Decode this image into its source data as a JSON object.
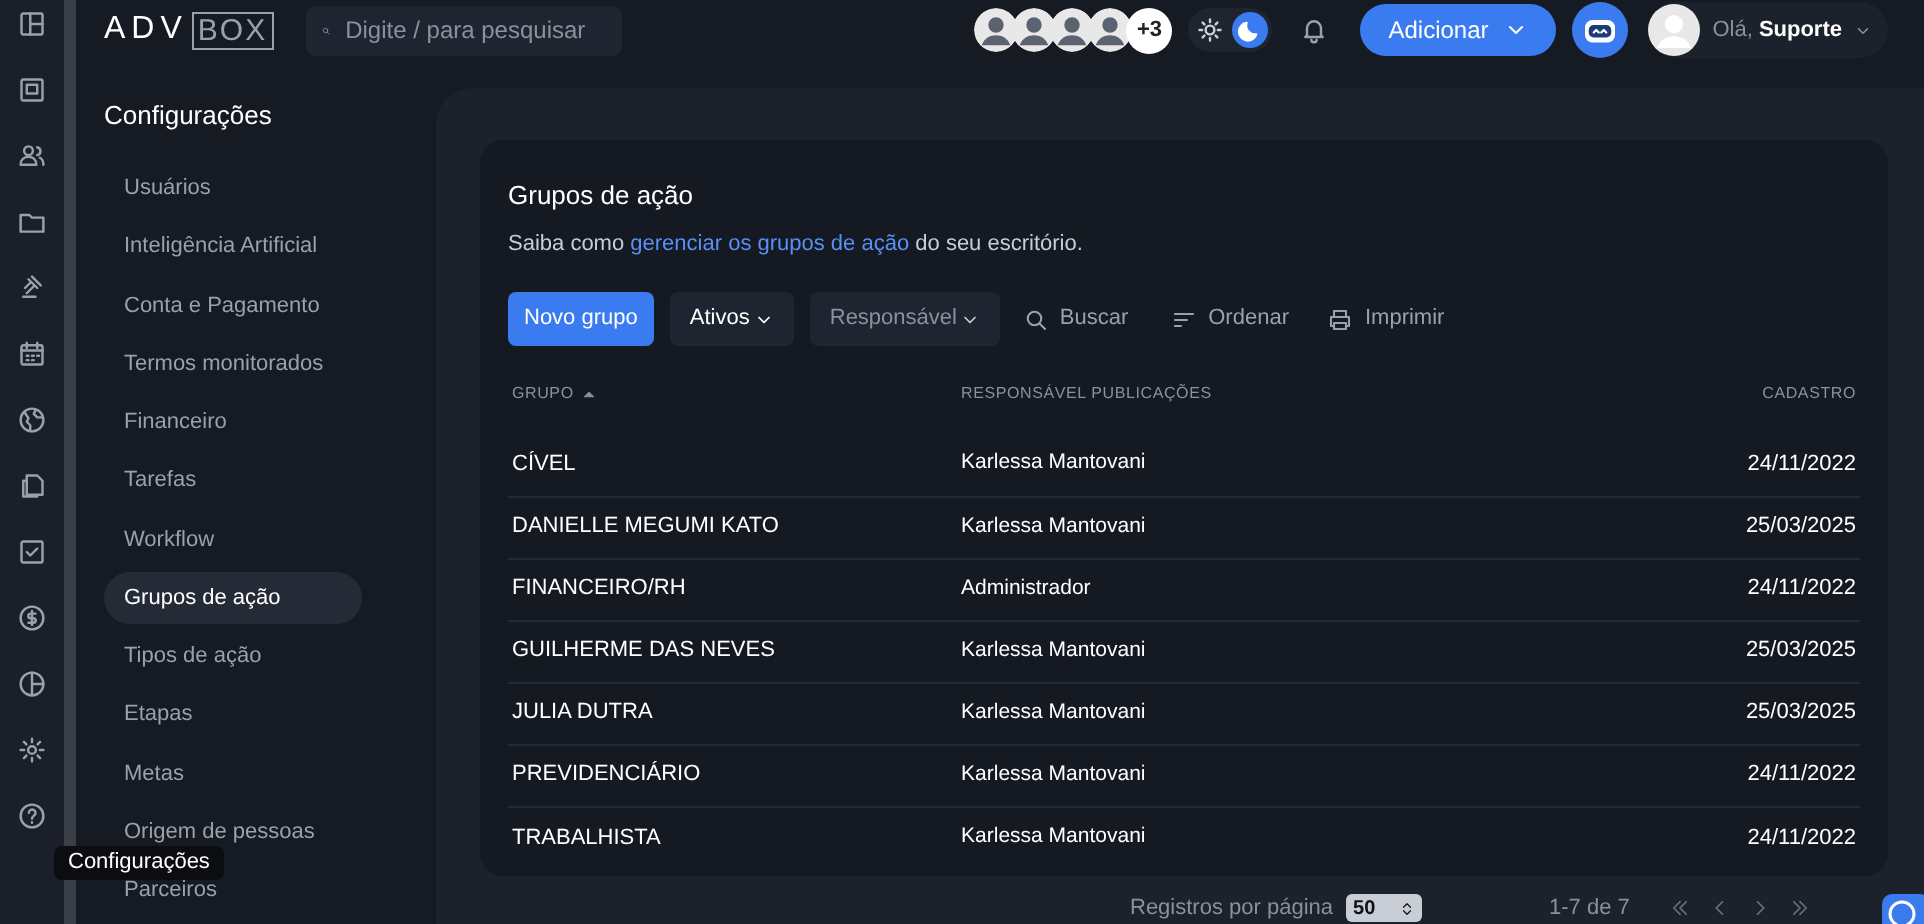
{
  "header": {
    "logo_left": "ADV",
    "logo_right": "BOX",
    "search": {
      "placeholder": "Digite / para pesquisar"
    },
    "avatars_more": "+3",
    "theme": {
      "dark": true
    },
    "add_button": "Adicionar",
    "user": {
      "greeting": "Olá,",
      "name": "Suporte"
    }
  },
  "settings_nav": {
    "title": "Configurações",
    "items": [
      {
        "label": "Usuários",
        "selected": false
      },
      {
        "label": "Inteligência Artificial",
        "selected": false
      },
      {
        "label": "Conta e Pagamento",
        "selected": false
      },
      {
        "label": "Termos monitorados",
        "selected": false
      },
      {
        "label": "Financeiro",
        "selected": false
      },
      {
        "label": "Tarefas",
        "selected": false
      },
      {
        "label": "Workflow",
        "selected": false
      },
      {
        "label": "Grupos de ação",
        "selected": true
      },
      {
        "label": "Tipos de ação",
        "selected": false
      },
      {
        "label": "Etapas",
        "selected": false
      },
      {
        "label": "Metas",
        "selected": false
      },
      {
        "label": "Origem de pessoas",
        "selected": false
      },
      {
        "label": "Parceiros",
        "selected": false
      }
    ]
  },
  "tooltip": "Configurações",
  "card": {
    "title": "Grupos de ação",
    "subtitle_before": "Saiba como",
    "subtitle_link": "gerenciar os grupos de ação",
    "subtitle_after": "do seu escritório.",
    "toolbar": {
      "new_button": "Novo grupo",
      "status_filter": "Ativos",
      "responsible_filter": "Responsável",
      "search": "Buscar",
      "sort": "Ordenar",
      "print": "Imprimir"
    },
    "table": {
      "columns": [
        "GRUPO",
        "RESPONSÁVEL PUBLICAÇÕES",
        "CADASTRO"
      ],
      "rows": [
        [
          "CÍVEL",
          "Karlessa Mantovani",
          "24/11/2022"
        ],
        [
          "DANIELLE MEGUMI KATO",
          "Karlessa Mantovani",
          "25/03/2025"
        ],
        [
          "FINANCEIRO/RH",
          "Administrador",
          "24/11/2022"
        ],
        [
          "GUILHERME DAS NEVES",
          "Karlessa Mantovani",
          "25/03/2025"
        ],
        [
          "JULIA DUTRA",
          "Karlessa Mantovani",
          "25/03/2025"
        ],
        [
          "PREVIDENCIÁRIO",
          "Karlessa Mantovani",
          "24/11/2022"
        ],
        [
          "TRABALHISTA",
          "Karlessa Mantovani",
          "24/11/2022"
        ]
      ]
    }
  },
  "pagination": {
    "per_page_label": "Registros por página",
    "per_page": "50",
    "range": "1-7 de 7"
  }
}
